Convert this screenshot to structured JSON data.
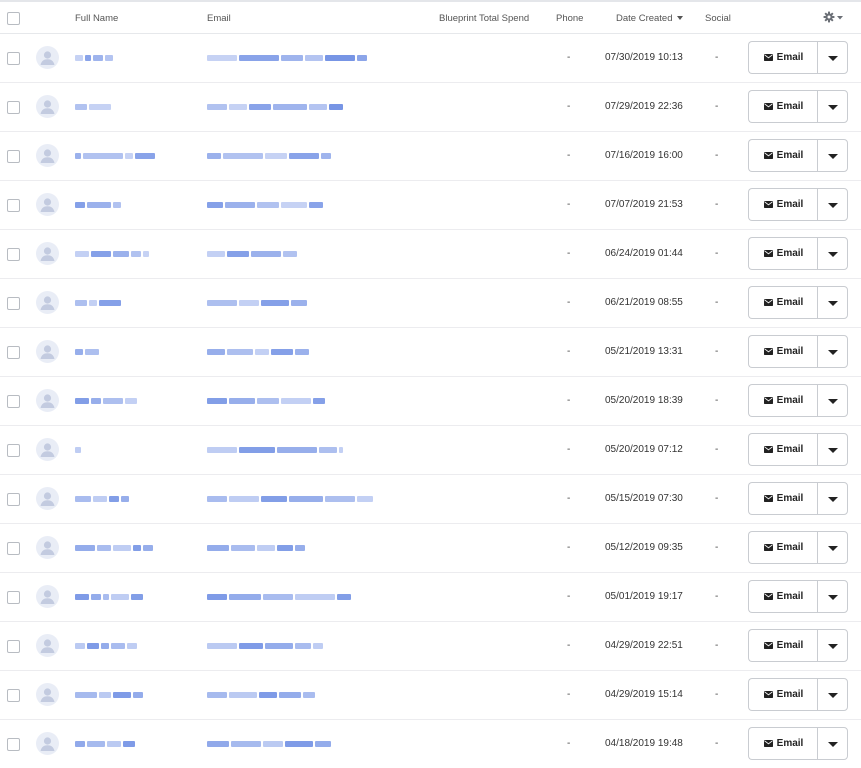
{
  "header": {
    "full_name": "Full Name",
    "email": "Email",
    "blueprint_total_spend": "Blueprint Total Spend",
    "phone": "Phone",
    "date_created": "Date Created",
    "social": "Social"
  },
  "icons": {
    "avatar": "user-avatar-icon",
    "settings": "gear-icon",
    "sort": "caret-down-icon",
    "mail": "envelope-icon",
    "dropdown": "caret-down-icon"
  },
  "colors": {
    "redaction": "#5b7fe0",
    "avatar_bg": "#e9edf6",
    "border": "#c9ccd1"
  },
  "rows": [
    {
      "phone": "-",
      "date": "07/30/2019 10:13",
      "social": "-",
      "action": "Email"
    },
    {
      "phone": "-",
      "date": "07/29/2019 22:36",
      "social": "-",
      "action": "Email"
    },
    {
      "phone": "-",
      "date": "07/16/2019 16:00",
      "social": "-",
      "action": "Email"
    },
    {
      "phone": "-",
      "date": "07/07/2019 21:53",
      "social": "-",
      "action": "Email"
    },
    {
      "phone": "-",
      "date": "06/24/2019 01:44",
      "social": "-",
      "action": "Email"
    },
    {
      "phone": "-",
      "date": "06/21/2019 08:55",
      "social": "-",
      "action": "Email"
    },
    {
      "phone": "-",
      "date": "05/21/2019 13:31",
      "social": "-",
      "action": "Email"
    },
    {
      "phone": "-",
      "date": "05/20/2019 18:39",
      "social": "-",
      "action": "Email"
    },
    {
      "phone": "-",
      "date": "05/20/2019 07:12",
      "social": "-",
      "action": "Email"
    },
    {
      "phone": "-",
      "date": "05/15/2019 07:30",
      "social": "-",
      "action": "Email"
    },
    {
      "phone": "-",
      "date": "05/12/2019 09:35",
      "social": "-",
      "action": "Email"
    },
    {
      "phone": "-",
      "date": "05/01/2019 19:17",
      "social": "-",
      "action": "Email"
    },
    {
      "phone": "-",
      "date": "04/29/2019 22:51",
      "social": "-",
      "action": "Email"
    },
    {
      "phone": "-",
      "date": "04/29/2019 15:14",
      "social": "-",
      "action": "Email"
    },
    {
      "phone": "-",
      "date": "04/18/2019 19:48",
      "social": "-",
      "action": "Email"
    }
  ]
}
